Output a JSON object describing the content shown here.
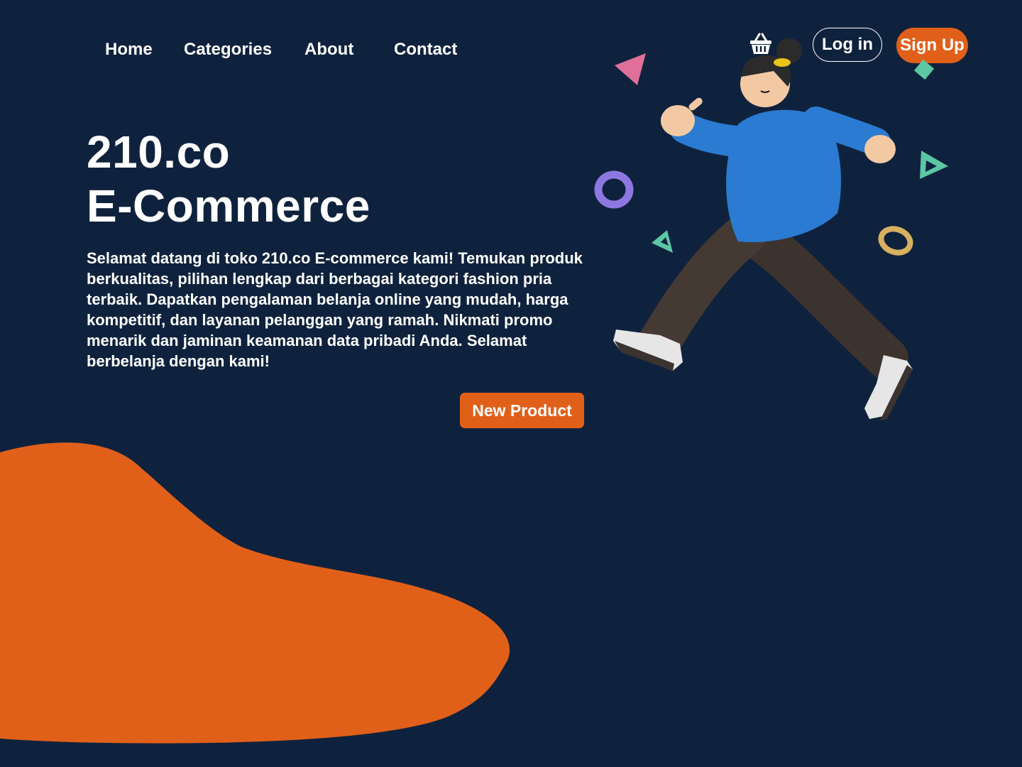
{
  "nav": {
    "items": [
      {
        "label": "Home"
      },
      {
        "label": "Categories"
      },
      {
        "label": "About"
      },
      {
        "label": "Contact"
      }
    ]
  },
  "header": {
    "cart_icon": "shopping-basket-icon",
    "login_label": "Log in",
    "signup_label": "Sign Up"
  },
  "hero": {
    "title_line1": "210.co",
    "title_line2": "E-Commerce",
    "description": "Selamat datang di toko 210.co E-commerce kami! Temukan produk berkualitas, pilihan lengkap dari berbagai kategori fashion pria terbaik. Dapatkan pengalaman belanja online yang mudah, harga kompetitif, dan layanan pelanggan yang ramah. Nikmati promo menarik dan jaminan keamanan data pribadi Anda. Selamat berbelanja dengan kami!",
    "cta_label": "New Product"
  },
  "colors": {
    "background": "#0f223d",
    "accent": "#e0601a",
    "text": "#ffffff"
  }
}
